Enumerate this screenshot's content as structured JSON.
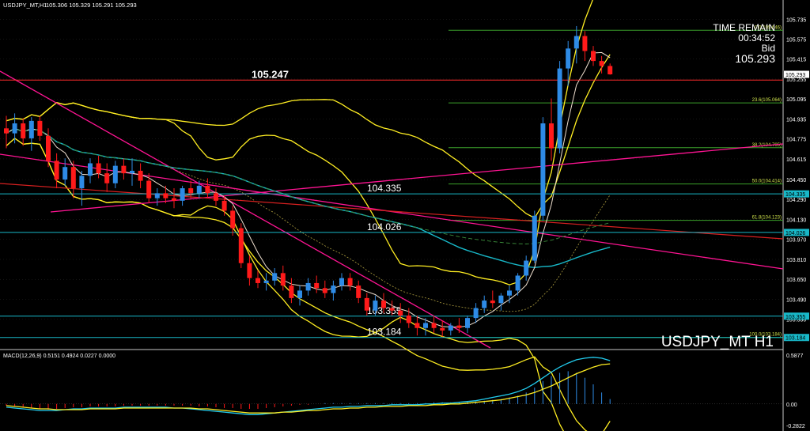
{
  "header": {
    "symbol_label": "USDJPY_MT,H1",
    "ohlc": "105.306 105.329 105.291 105.293"
  },
  "info_box": {
    "time_remain_label": "TIME REMAIN",
    "time_remain_value": "00:34:52",
    "bid_label": "Bid",
    "bid_value": "105.293"
  },
  "watermark": "USDJPY_MT H1",
  "price_axis": {
    "ticks": [
      "105.735",
      "105.575",
      "105.415",
      "105.255",
      "105.095",
      "104.935",
      "104.775",
      "104.615",
      "104.450",
      "104.290",
      "104.130",
      "103.970",
      "103.810",
      "103.650",
      "103.490",
      "103.330"
    ],
    "current_price_tag": "105.293",
    "level_tags": [
      "104.335",
      "104.026",
      "103.355",
      "103.184"
    ]
  },
  "levels": [
    {
      "price": 105.247,
      "label": "105.247",
      "color": "#ff2a2a"
    },
    {
      "price": 104.335,
      "label": "104.335",
      "color": "#18b8c8"
    },
    {
      "price": 104.026,
      "label": "104.026",
      "color": "#18b8c8"
    },
    {
      "price": 103.355,
      "label": "103.355",
      "color": "#18b8c8"
    },
    {
      "price": 103.184,
      "label": "103.184",
      "color": "#18b8c8"
    }
  ],
  "fibonacci": [
    {
      "label": "0.0(105.646)",
      "price": 105.646
    },
    {
      "label": "23.6(105.064)",
      "price": 105.064
    },
    {
      "label": "38.2(104.705)",
      "price": 104.705
    },
    {
      "label": "50.0(104.414)",
      "price": 104.414
    },
    {
      "label": "61.8(104.123)",
      "price": 104.123
    },
    {
      "label": "100.0(103.184)",
      "price": 103.184
    }
  ],
  "macd": {
    "label": "MACD(12,26,9) 0.5151 0.4924 0.0227 0.0000",
    "ticks": [
      "0.5877",
      "0.00",
      "-0.2822"
    ]
  },
  "colors": {
    "bull": "#2e8be6",
    "bear": "#ff1a1a",
    "bollinger": "#ffee22",
    "grid": "#2a2a2a",
    "fib": "#3aa02a",
    "ma_slow": "#18b8c8",
    "trend_magenta": "#ff1493"
  },
  "chart_data": {
    "type": "candlestick",
    "ylim": [
      103.1,
      105.8
    ],
    "candles": [
      [
        104.86,
        104.96,
        104.7,
        104.82
      ],
      [
        104.82,
        104.98,
        104.74,
        104.9
      ],
      [
        104.9,
        104.94,
        104.72,
        104.78
      ],
      [
        104.78,
        104.95,
        104.68,
        104.92
      ],
      [
        104.92,
        104.96,
        104.76,
        104.8
      ],
      [
        104.8,
        104.86,
        104.55,
        104.6
      ],
      [
        104.6,
        104.66,
        104.38,
        104.45
      ],
      [
        104.45,
        104.62,
        104.4,
        104.55
      ],
      [
        104.55,
        104.6,
        104.3,
        104.38
      ],
      [
        104.38,
        104.52,
        104.24,
        104.48
      ],
      [
        104.48,
        104.62,
        104.42,
        104.58
      ],
      [
        104.58,
        104.64,
        104.46,
        104.5
      ],
      [
        104.5,
        104.58,
        104.35,
        104.42
      ],
      [
        104.42,
        104.6,
        104.38,
        104.56
      ],
      [
        104.56,
        104.62,
        104.45,
        104.5
      ],
      [
        104.5,
        104.62,
        104.4,
        104.52
      ],
      [
        104.52,
        104.58,
        104.38,
        104.44
      ],
      [
        104.44,
        104.5,
        104.26,
        104.3
      ],
      [
        104.3,
        104.38,
        104.24,
        104.34
      ],
      [
        104.34,
        104.4,
        104.26,
        104.3
      ],
      [
        104.3,
        104.38,
        104.22,
        104.28
      ],
      [
        104.28,
        104.4,
        104.24,
        104.38
      ],
      [
        104.38,
        104.44,
        104.3,
        104.34
      ],
      [
        104.34,
        104.44,
        104.3,
        104.4
      ],
      [
        104.4,
        104.46,
        104.3,
        104.34
      ],
      [
        104.34,
        104.38,
        104.24,
        104.28
      ],
      [
        104.28,
        104.32,
        104.16,
        104.2
      ],
      [
        104.2,
        104.24,
        104.0,
        104.06
      ],
      [
        104.06,
        104.1,
        103.74,
        103.78
      ],
      [
        103.78,
        103.84,
        103.6,
        103.66
      ],
      [
        103.66,
        103.72,
        103.58,
        103.62
      ],
      [
        103.62,
        103.7,
        103.56,
        103.64
      ],
      [
        103.64,
        103.74,
        103.6,
        103.7
      ],
      [
        103.7,
        103.76,
        103.56,
        103.6
      ],
      [
        103.6,
        103.66,
        103.46,
        103.5
      ],
      [
        103.5,
        103.6,
        103.44,
        103.56
      ],
      [
        103.56,
        103.66,
        103.52,
        103.62
      ],
      [
        103.62,
        103.68,
        103.54,
        103.58
      ],
      [
        103.58,
        103.64,
        103.5,
        103.54
      ],
      [
        103.54,
        103.64,
        103.48,
        103.6
      ],
      [
        103.6,
        103.7,
        103.56,
        103.66
      ],
      [
        103.66,
        103.7,
        103.56,
        103.6
      ],
      [
        103.6,
        103.64,
        103.46,
        103.5
      ],
      [
        103.5,
        103.54,
        103.36,
        103.4
      ],
      [
        103.4,
        103.52,
        103.36,
        103.48
      ],
      [
        103.48,
        103.54,
        103.38,
        103.42
      ],
      [
        103.42,
        103.48,
        103.36,
        103.4
      ],
      [
        103.4,
        103.46,
        103.3,
        103.36
      ],
      [
        103.36,
        103.42,
        103.26,
        103.3
      ],
      [
        103.3,
        103.36,
        103.2,
        103.26
      ],
      [
        103.26,
        103.34,
        103.2,
        103.3
      ],
      [
        103.3,
        103.36,
        103.22,
        103.26
      ],
      [
        103.26,
        103.32,
        103.19,
        103.24
      ],
      [
        103.24,
        103.3,
        103.2,
        103.28
      ],
      [
        103.28,
        103.34,
        103.22,
        103.26
      ],
      [
        103.26,
        103.36,
        103.22,
        103.34
      ],
      [
        103.34,
        103.46,
        103.3,
        103.42
      ],
      [
        103.42,
        103.52,
        103.38,
        103.48
      ],
      [
        103.48,
        103.56,
        103.42,
        103.46
      ],
      [
        103.46,
        103.54,
        103.4,
        103.52
      ],
      [
        103.52,
        103.6,
        103.46,
        103.56
      ],
      [
        103.56,
        103.7,
        103.52,
        103.68
      ],
      [
        103.68,
        103.84,
        103.64,
        103.8
      ],
      [
        103.8,
        104.2,
        103.78,
        104.16
      ],
      [
        104.16,
        104.95,
        104.12,
        104.9
      ],
      [
        104.9,
        105.1,
        104.6,
        104.7
      ],
      [
        104.7,
        105.4,
        104.66,
        105.34
      ],
      [
        105.34,
        105.56,
        105.2,
        105.5
      ],
      [
        105.5,
        105.68,
        105.38,
        105.6
      ],
      [
        105.6,
        105.64,
        105.4,
        105.48
      ],
      [
        105.48,
        105.52,
        105.36,
        105.4
      ],
      [
        105.4,
        105.44,
        105.3,
        105.36
      ],
      [
        105.36,
        105.38,
        105.29,
        105.293
      ]
    ],
    "macd_histogram": [
      -0.02,
      -0.03,
      -0.04,
      -0.05,
      -0.06,
      -0.07,
      -0.06,
      -0.05,
      -0.04,
      -0.04,
      -0.03,
      -0.03,
      -0.03,
      -0.03,
      -0.02,
      -0.02,
      -0.02,
      -0.02,
      -0.02,
      -0.02,
      -0.02,
      -0.02,
      -0.02,
      -0.03,
      -0.03,
      -0.04,
      -0.05,
      -0.05,
      -0.06,
      -0.06,
      -0.06,
      -0.05,
      -0.04,
      -0.03,
      -0.02,
      -0.01,
      -0.01,
      0.0,
      0.01,
      0.01,
      0.01,
      0.01,
      0.01,
      0.01,
      0.01,
      0.01,
      0.01,
      0.01,
      0.01,
      0.01,
      0.01,
      0.02,
      0.02,
      0.02,
      0.02,
      0.03,
      0.03,
      0.04,
      0.05,
      0.06,
      0.08,
      0.1,
      0.14,
      0.2,
      0.28,
      0.34,
      0.38,
      0.4,
      0.38,
      0.32,
      0.24,
      0.14,
      0.06
    ],
    "macd_line": [
      -0.04,
      -0.05,
      -0.06,
      -0.07,
      -0.08,
      -0.08,
      -0.08,
      -0.07,
      -0.06,
      -0.06,
      -0.05,
      -0.05,
      -0.05,
      -0.05,
      -0.04,
      -0.04,
      -0.04,
      -0.04,
      -0.04,
      -0.04,
      -0.05,
      -0.05,
      -0.06,
      -0.07,
      -0.08,
      -0.09,
      -0.1,
      -0.11,
      -0.12,
      -0.13,
      -0.13,
      -0.12,
      -0.11,
      -0.1,
      -0.09,
      -0.08,
      -0.07,
      -0.06,
      -0.05,
      -0.04,
      -0.04,
      -0.03,
      -0.03,
      -0.02,
      -0.02,
      -0.02,
      -0.01,
      -0.01,
      -0.01,
      -0.01,
      0.0,
      0.0,
      0.01,
      0.01,
      0.02,
      0.03,
      0.04,
      0.06,
      0.08,
      0.1,
      0.12,
      0.15,
      0.19,
      0.25,
      0.32,
      0.39,
      0.45,
      0.5,
      0.54,
      0.56,
      0.57,
      0.56,
      0.53
    ],
    "signal_line": [
      -0.02,
      -0.03,
      -0.04,
      -0.05,
      -0.06,
      -0.06,
      -0.07,
      -0.07,
      -0.07,
      -0.07,
      -0.06,
      -0.06,
      -0.06,
      -0.06,
      -0.05,
      -0.05,
      -0.05,
      -0.05,
      -0.05,
      -0.05,
      -0.05,
      -0.05,
      -0.05,
      -0.06,
      -0.06,
      -0.07,
      -0.08,
      -0.09,
      -0.1,
      -0.11,
      -0.11,
      -0.11,
      -0.11,
      -0.1,
      -0.1,
      -0.09,
      -0.08,
      -0.08,
      -0.07,
      -0.06,
      -0.06,
      -0.05,
      -0.05,
      -0.04,
      -0.04,
      -0.03,
      -0.03,
      -0.03,
      -0.02,
      -0.02,
      -0.02,
      -0.01,
      -0.01,
      0.0,
      0.0,
      0.01,
      0.02,
      0.03,
      0.04,
      0.05,
      0.07,
      0.09,
      0.11,
      0.14,
      0.18,
      0.22,
      0.27,
      0.32,
      0.37,
      0.41,
      0.45,
      0.48,
      0.49
    ]
  }
}
